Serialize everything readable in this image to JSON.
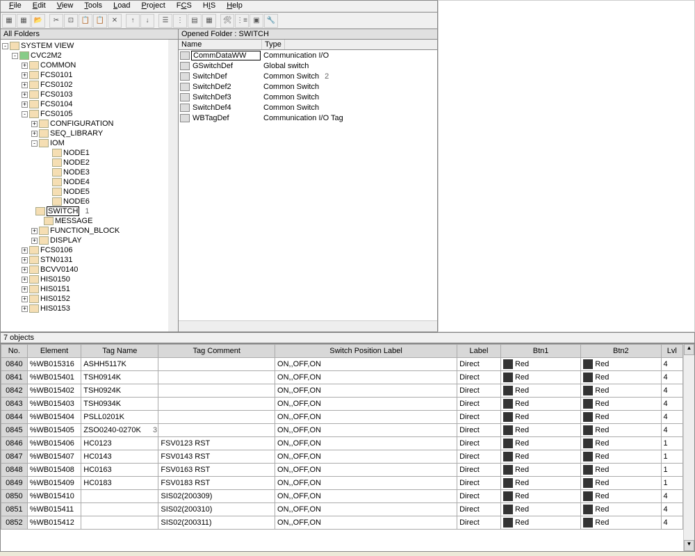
{
  "menu": [
    "File",
    "Edit",
    "View",
    "Tools",
    "Load",
    "Project",
    "FCS",
    "HIS",
    "Help"
  ],
  "toolbar_icons": [
    "doc",
    "doc2",
    "open",
    "cut",
    "copy",
    "paste",
    "paste2",
    "del",
    "up",
    "down",
    "",
    "grp",
    "list",
    "grid",
    "tree",
    "",
    "props",
    "cfg",
    "chart",
    "tool"
  ],
  "left": {
    "title": "All Folders",
    "tree": {
      "root": "SYSTEM VIEW",
      "project": "CVC2M2",
      "nodes": [
        "COMMON",
        "FCS0101",
        "FCS0102",
        "FCS0103",
        "FCS0104"
      ],
      "fcs_open": "FCS0105",
      "fcs_children": [
        "CONFIGURATION",
        "SEQ_LIBRARY"
      ],
      "iom": "IOM",
      "iom_nodes": [
        "NODE1",
        "NODE2",
        "NODE3",
        "NODE4",
        "NODE5",
        "NODE6"
      ],
      "switch": "SWITCH",
      "switch_annot": "1",
      "after_switch": [
        "MESSAGE",
        "FUNCTION_BLOCK",
        "DISPLAY"
      ],
      "tail": [
        "FCS0106",
        "STN0131",
        "BCVV0140",
        "HIS0150",
        "HIS0151",
        "HIS0152",
        "HIS0153"
      ]
    }
  },
  "right": {
    "title": "Opened Folder : SWITCH",
    "headers": [
      "Name",
      "Type"
    ],
    "rows": [
      {
        "name": "CommDataWW",
        "type": "Communication I/O",
        "sel": true
      },
      {
        "name": "GSwitchDef",
        "type": "Global switch"
      },
      {
        "name": "SwitchDef",
        "type": "Common Switch",
        "annot": "2"
      },
      {
        "name": "SwitchDef2",
        "type": "Common Switch"
      },
      {
        "name": "SwitchDef3",
        "type": "Common Switch"
      },
      {
        "name": "SwitchDef4",
        "type": "Common Switch"
      },
      {
        "name": "WBTagDef",
        "type": "Communication I/O Tag"
      }
    ]
  },
  "status": "7 objects",
  "grid": {
    "headers": [
      "No.",
      "Element",
      "Tag Name",
      "Tag Comment",
      "Switch Position Label",
      "Label",
      "Btn1",
      "Btn2",
      "Lvl"
    ],
    "row_annot": "3",
    "rows": [
      {
        "no": "0840",
        "el": "%WB015316",
        "tag": "ASHH5117K",
        "cmt": "",
        "spl": "ON,,OFF,ON",
        "lbl": "Direct",
        "b1": "Red",
        "b2": "Red",
        "lvl": "4"
      },
      {
        "no": "0841",
        "el": "%WB015401",
        "tag": "TSH0914K",
        "cmt": "",
        "spl": "ON,,OFF,ON",
        "lbl": "Direct",
        "b1": "Red",
        "b2": "Red",
        "lvl": "4"
      },
      {
        "no": "0842",
        "el": "%WB015402",
        "tag": "TSH0924K",
        "cmt": "",
        "spl": "ON,,OFF,ON",
        "lbl": "Direct",
        "b1": "Red",
        "b2": "Red",
        "lvl": "4"
      },
      {
        "no": "0843",
        "el": "%WB015403",
        "tag": "TSH0934K",
        "cmt": "",
        "spl": "ON,,OFF,ON",
        "lbl": "Direct",
        "b1": "Red",
        "b2": "Red",
        "lvl": "4"
      },
      {
        "no": "0844",
        "el": "%WB015404",
        "tag": "PSLL0201K",
        "cmt": "",
        "spl": "ON,,OFF,ON",
        "lbl": "Direct",
        "b1": "Red",
        "b2": "Red",
        "lvl": "4"
      },
      {
        "no": "0845",
        "el": "%WB015405",
        "tag": "ZSO0240-0270K",
        "cmt": "",
        "spl": "ON,,OFF,ON",
        "lbl": "Direct",
        "b1": "Red",
        "b2": "Red",
        "lvl": "4",
        "annot": true
      },
      {
        "no": "0846",
        "el": "%WB015406",
        "tag": "HC0123",
        "cmt": "FSV0123 RST",
        "spl": "ON,,OFF,ON",
        "lbl": "Direct",
        "b1": "Red",
        "b2": "Red",
        "lvl": "1"
      },
      {
        "no": "0847",
        "el": "%WB015407",
        "tag": "HC0143",
        "cmt": "FSV0143 RST",
        "spl": "ON,,OFF,ON",
        "lbl": "Direct",
        "b1": "Red",
        "b2": "Red",
        "lvl": "1"
      },
      {
        "no": "0848",
        "el": "%WB015408",
        "tag": "HC0163",
        "cmt": "FSV0163 RST",
        "spl": "ON,,OFF,ON",
        "lbl": "Direct",
        "b1": "Red",
        "b2": "Red",
        "lvl": "1"
      },
      {
        "no": "0849",
        "el": "%WB015409",
        "tag": "HC0183",
        "cmt": "FSV0183 RST",
        "spl": "ON,,OFF,ON",
        "lbl": "Direct",
        "b1": "Red",
        "b2": "Red",
        "lvl": "1"
      },
      {
        "no": "0850",
        "el": "%WB015410",
        "tag": "",
        "cmt": "SIS02(200309)",
        "spl": "ON,,OFF,ON",
        "lbl": "Direct",
        "b1": "Red",
        "b2": "Red",
        "lvl": "4"
      },
      {
        "no": "0851",
        "el": "%WB015411",
        "tag": "",
        "cmt": "SIS02(200310)",
        "spl": "ON,,OFF,ON",
        "lbl": "Direct",
        "b1": "Red",
        "b2": "Red",
        "lvl": "4"
      },
      {
        "no": "0852",
        "el": "%WB015412",
        "tag": "",
        "cmt": "SIS02(200311)",
        "spl": "ON,,OFF,ON",
        "lbl": "Direct",
        "b1": "Red",
        "b2": "Red",
        "lvl": "4"
      }
    ]
  }
}
